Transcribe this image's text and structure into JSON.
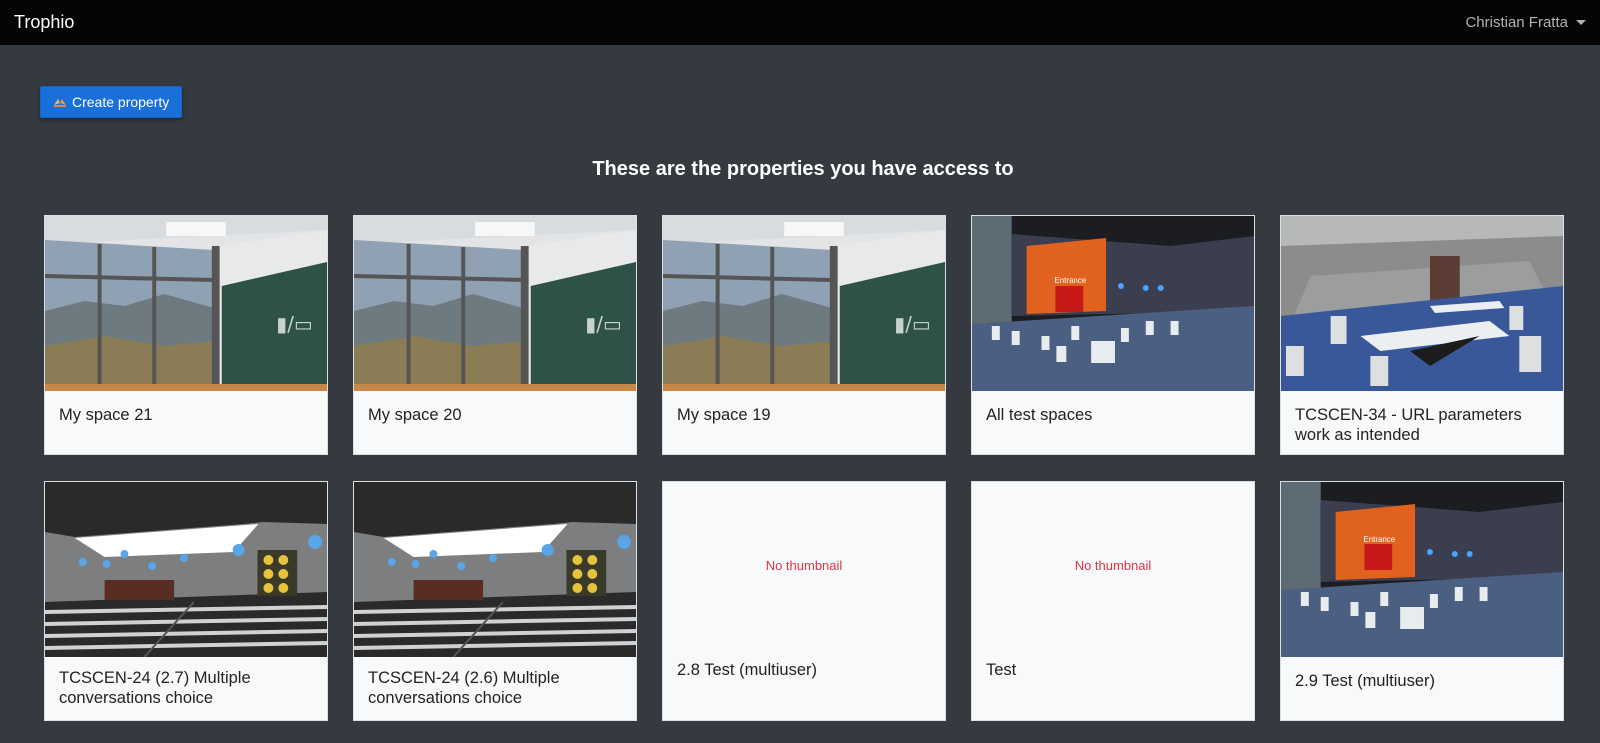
{
  "navbar": {
    "brand": "Trophio",
    "user": "Christian Fratta"
  },
  "toolbar": {
    "create_label": "Create property",
    "create_icon": "hands-icon"
  },
  "heading": "These are the properties you have access to",
  "cards": [
    {
      "title": "My space 21",
      "thumb": "classroom"
    },
    {
      "title": "My space 20",
      "thumb": "classroom"
    },
    {
      "title": "My space 19",
      "thumb": "classroom"
    },
    {
      "title": "All test spaces",
      "thumb": "event-hall",
      "thumb_text": "Entrance"
    },
    {
      "title": "TCSCEN-34 - URL parameters work as intended",
      "thumb": "meeting-room"
    },
    {
      "title": "TCSCEN-24 (2.7) Multiple conversations choice",
      "thumb": "auditorium"
    },
    {
      "title": "TCSCEN-24 (2.6) Multiple conversations choice",
      "thumb": "auditorium"
    },
    {
      "title": "2.8 Test (multiuser)",
      "thumb": "none",
      "no_thumb_text": "No thumbnail"
    },
    {
      "title": "Test",
      "thumb": "none",
      "no_thumb_text": "No thumbnail"
    },
    {
      "title": "2.9 Test (multiuser)",
      "thumb": "event-hall",
      "thumb_text": "Entrance"
    }
  ]
}
